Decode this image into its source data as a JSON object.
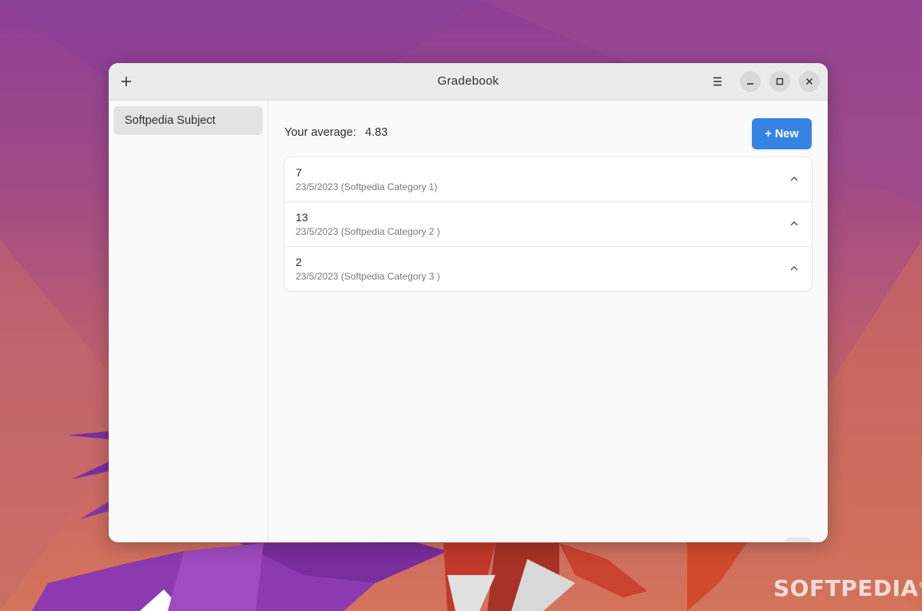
{
  "window": {
    "title": "Gradebook"
  },
  "header": {
    "add_icon": "plus-icon",
    "menu_icon": "hamburger-menu-icon",
    "minimize_icon": "minimize-icon",
    "maximize_icon": "maximize-icon",
    "close_icon": "close-icon"
  },
  "sidebar": {
    "items": [
      {
        "label": "Softpedia Subject",
        "selected": true
      }
    ]
  },
  "main": {
    "average_label": "Your average:",
    "average_value": "4.83",
    "new_button_label": "+ New",
    "grades": [
      {
        "value": "7",
        "details": "23/5/2023 (Softpedia Category 1)"
      },
      {
        "value": "13",
        "details": "23/5/2023 (Softpedia Category 2 )"
      },
      {
        "value": "2",
        "details": "23/5/2023 (Softpedia Category 3 )"
      }
    ],
    "edit_icon": "edit-pencil-icon"
  },
  "watermark": {
    "text": "SOFTPEDIA",
    "mark": "®"
  },
  "colors": {
    "accent": "#3584e4",
    "window_bg": "#fafafa",
    "header_bg": "#ebebeb"
  }
}
